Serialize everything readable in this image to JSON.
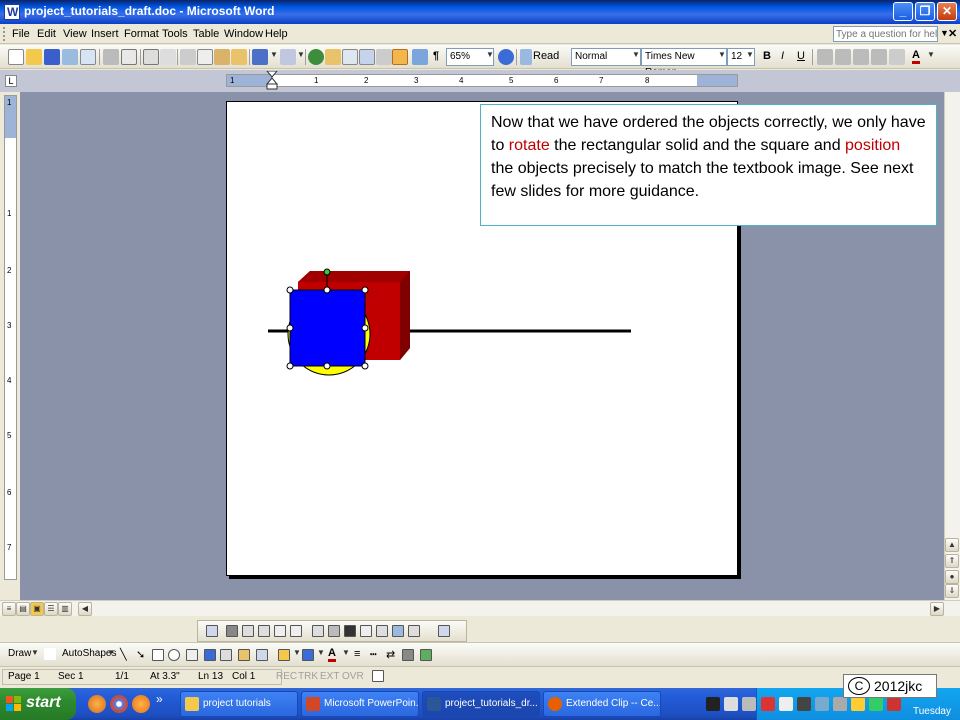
{
  "window": {
    "title": "project_tutorials_draft.doc - Microsoft Word",
    "controls": [
      "_",
      "❐",
      "✕"
    ]
  },
  "menu": {
    "items": [
      "File",
      "Edit",
      "View",
      "Insert",
      "Format",
      "Tools",
      "Table",
      "Window",
      "Help"
    ],
    "help_placeholder": "Type a question for help"
  },
  "toolbar": {
    "zoom": "65%",
    "read_label": "Read",
    "pilcrow": "¶",
    "style": "Normal",
    "font": "Times New Roman",
    "font_size": "12",
    "bold": "B",
    "italic": "I",
    "underline": "U",
    "font_color_label": "A"
  },
  "ruler": {
    "h_numbers": [
      "1",
      "1",
      "2",
      "3",
      "4",
      "5",
      "6",
      "7",
      "8"
    ],
    "v_numbers": [
      "1",
      "1",
      "2",
      "3",
      "4",
      "5",
      "6",
      "7"
    ],
    "corner": "L"
  },
  "callout": {
    "part1": "Now that we have ordered the objects correctly, we only have to ",
    "highlight1": "rotate",
    "part2": " the rectangular solid and the square and ",
    "highlight2": "position",
    "part3": " the objects precisely to match the textbook image. See next few slides for more guidance."
  },
  "drawing_toolbar": {
    "draw_label": "Draw",
    "autoshapes_label": "AutoShapes",
    "font_color_label": "A"
  },
  "status": {
    "page": "Page 1",
    "sec": "Sec 1",
    "pages": "1/1",
    "at": "At 3.3\"",
    "ln": "Ln 13",
    "col": "Col 1",
    "rec": "REC",
    "trk": "TRK",
    "ext": "EXT",
    "ovr": "OVR"
  },
  "taskbar": {
    "start_label": "start",
    "chevron": "»",
    "tasks": [
      {
        "label": "project tutorials",
        "icon": "folder-icon",
        "active": false
      },
      {
        "label": "Microsoft PowerPoin...",
        "icon": "powerpoint-icon",
        "active": false
      },
      {
        "label": "project_tutorials_dr...",
        "icon": "word-icon",
        "active": true
      },
      {
        "label": "Extended Clip -- Ce...",
        "icon": "firefox-icon",
        "active": false
      }
    ],
    "tray_day": "Tuesday"
  },
  "copyright": {
    "symbol": "C",
    "text": "2012jkc"
  },
  "colors": {
    "accent_red": "#c00000",
    "shape_blue": "#0000ff",
    "shape_red": "#c00000",
    "shape_yellow": "#ffff00",
    "callout_border": "#4fb3c6"
  }
}
